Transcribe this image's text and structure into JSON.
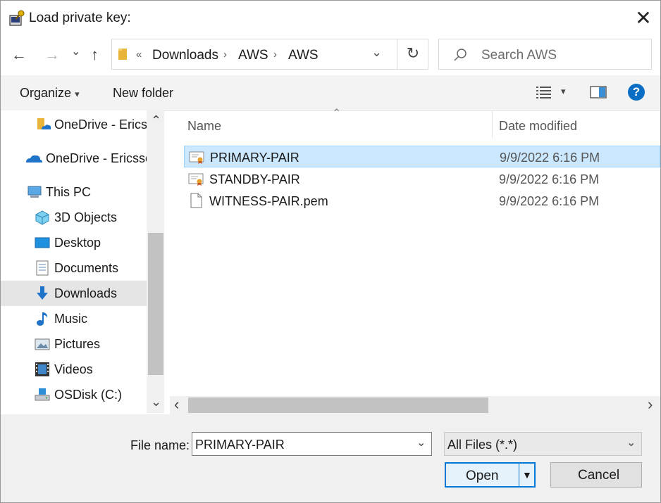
{
  "window": {
    "title": "Load private key:",
    "close_glyph": "✕"
  },
  "nav": {
    "back_glyph": "←",
    "forward_glyph": "→",
    "recent_glyph": "⌄",
    "up_glyph": "↑"
  },
  "address": {
    "overflow": "«",
    "segments": [
      "Downloads",
      "AWS",
      "AWS"
    ],
    "separator": "›",
    "dropdown_glyph": "⌄",
    "refresh_glyph": "↻"
  },
  "search": {
    "placeholder": "Search AWS"
  },
  "toolbar": {
    "organize": "Organize",
    "organize_arrow": "▾",
    "new_folder": "New folder",
    "view_arrow": "▾",
    "help": "?"
  },
  "sidebar": {
    "items": [
      {
        "label": "OneDrive - Ericss",
        "icon": "onedrive-folder-icon"
      },
      {
        "label": "OneDrive - Ericsso",
        "icon": "onedrive-cloud-icon"
      },
      {
        "label": "This PC",
        "icon": "computer-icon"
      },
      {
        "label": "3D Objects",
        "icon": "3d-objects-icon"
      },
      {
        "label": "Desktop",
        "icon": "desktop-icon"
      },
      {
        "label": "Documents",
        "icon": "documents-icon"
      },
      {
        "label": "Downloads",
        "icon": "downloads-icon"
      },
      {
        "label": "Music",
        "icon": "music-icon"
      },
      {
        "label": "Pictures",
        "icon": "pictures-icon"
      },
      {
        "label": "Videos",
        "icon": "videos-icon"
      },
      {
        "label": "OSDisk (C:)",
        "icon": "disk-icon"
      }
    ],
    "scroll_up": "⌃",
    "scroll_down": "⌄"
  },
  "filelist": {
    "columns": {
      "name": "Name",
      "date": "Date modified"
    },
    "sort_indicator": "⌃",
    "rows": [
      {
        "name": "PRIMARY-PAIR",
        "date": "9/9/2022 6:16 PM",
        "icon": "certificate-icon"
      },
      {
        "name": "STANDBY-PAIR",
        "date": "9/9/2022 6:16 PM",
        "icon": "certificate-icon"
      },
      {
        "name": "WITNESS-PAIR.pem",
        "date": "9/9/2022 6:16 PM",
        "icon": "file-icon"
      }
    ],
    "hscroll_left": "‹",
    "hscroll_right": "›"
  },
  "footer": {
    "filename_label": "File name:",
    "filename_value": "PRIMARY-PAIR",
    "filter_value": "All Files (*.*)",
    "dropdown_glyph": "⌄",
    "open_label": "Open",
    "open_arrow": "▼",
    "cancel_label": "Cancel"
  },
  "colors": {
    "accent": "#0078d7",
    "selection": "#cce8ff",
    "selection_border": "#99d1ff",
    "help_blue": "#0a6fc4",
    "folder_yellow": "#e8b53a"
  }
}
